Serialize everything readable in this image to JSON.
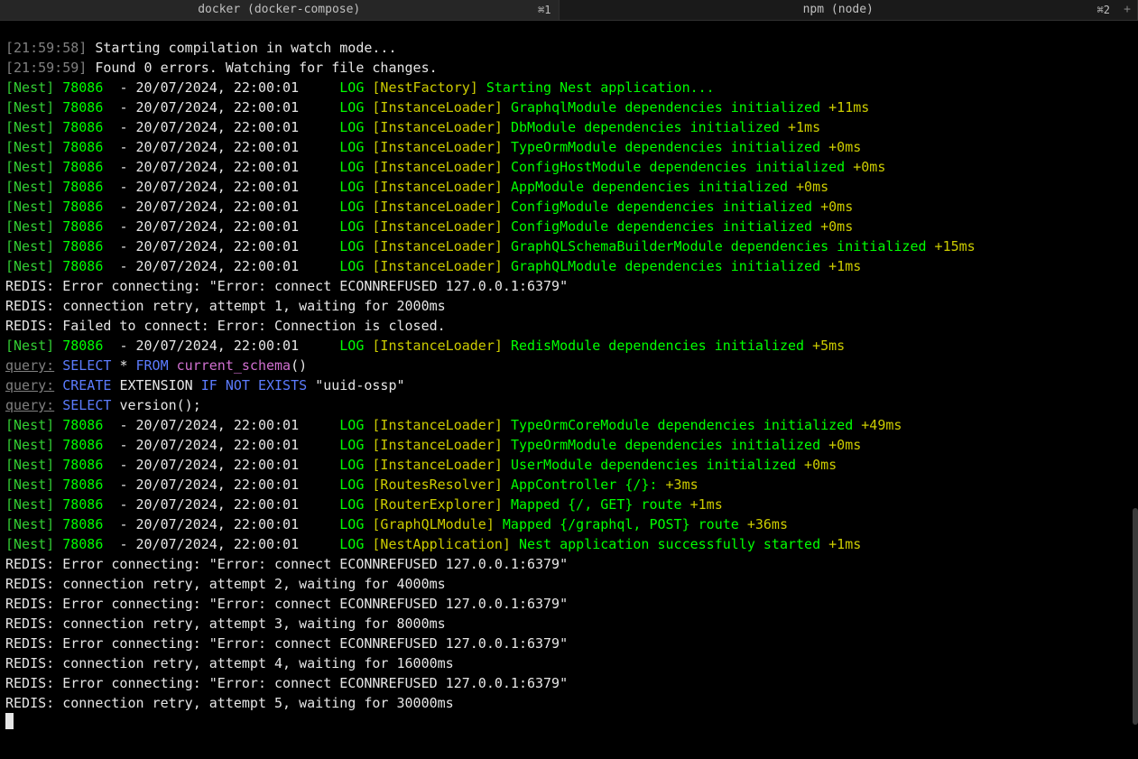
{
  "tabs": [
    {
      "title": "docker (docker-compose)",
      "badge": "⌘1",
      "active": true
    },
    {
      "title": "npm (node)",
      "badge": "⌘2",
      "active": false
    }
  ],
  "add_button": "+",
  "pre": [
    "[21:59:58] Starting compilation in watch mode...",
    "[21:59:59] Found 0 errors. Watching for file changes."
  ],
  "pid": "78086",
  "ts": "20/07/2024, 22:00:01",
  "log": "LOG",
  "nest": "[Nest]",
  "ctx": {
    "nf": "[NestFactory]",
    "il": "[InstanceLoader]",
    "rr": "[RoutesResolver]",
    "re": "[RouterExplorer]",
    "gm": "[GraphQLModule]",
    "na": "[NestApplication]"
  },
  "msg": {
    "start": "Starting Nest application...",
    "gql": "GraphqlModule dependencies initialized",
    "db": "DbModule dependencies initialized",
    "torm": "TypeOrmModule dependencies initialized",
    "cfgh": "ConfigHostModule dependencies initialized",
    "app": "AppModule dependencies initialized",
    "cfg1": "ConfigModule dependencies initialized",
    "cfg2": "ConfigModule dependencies initialized",
    "sb": "GraphQLSchemaBuilderModule dependencies initialized",
    "gqlm": "GraphQLModule dependencies initialized",
    "redis": "RedisModule dependencies initialized",
    "tormcore": "TypeOrmCoreModule dependencies initialized",
    "torm2": "TypeOrmModule dependencies initialized",
    "user": "UserModule dependencies initialized",
    "appctrl": "AppController {/}:",
    "mapget": "Mapped {/, GET} route",
    "mapgql": "Mapped {/graphql, POST} route",
    "ok": "Nest application successfully started"
  },
  "dur": {
    "d11": "+11ms",
    "d1": "+1ms",
    "d0": "+0ms",
    "d15": "+15ms",
    "d5": "+5ms",
    "d49": "+49ms",
    "d3": "+3ms",
    "d36": "+36ms"
  },
  "redis": {
    "err": "REDIS: Error connecting: \"Error: connect ECONNREFUSED 127.0.0.1:6379\"",
    "retry1": "REDIS: connection retry, attempt 1, waiting for 2000ms",
    "fail": "REDIS: Failed to connect: Error: Connection is closed.",
    "retry2": "REDIS: connection retry, attempt 2, waiting for 4000ms",
    "retry3": "REDIS: connection retry, attempt 3, waiting for 8000ms",
    "retry4": "REDIS: connection retry, attempt 4, waiting for 16000ms",
    "retry5": "REDIS: connection retry, attempt 5, waiting for 30000ms"
  },
  "query_label": "query:",
  "sql": {
    "select": "SELECT",
    "from": "FROM",
    "create": "CREATE",
    "ext": "EXTENSION",
    "if": "IF",
    "not": "NOT",
    "exists": "EXISTS"
  },
  "sqltxt": {
    "star": "* ",
    "cs": "current_schema",
    "paren": "()",
    "uuid": "\"uuid-ossp\"",
    "ver": "version();"
  }
}
